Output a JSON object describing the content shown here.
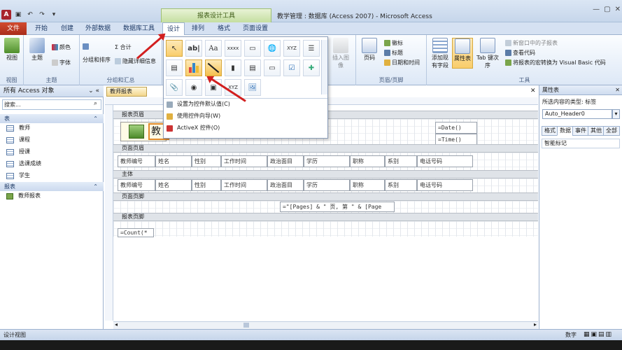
{
  "window": {
    "title": "教学管理 : 数据库 (Access 2007) - Microsoft Access",
    "context_tab": "报表设计工具",
    "controls": [
      "—",
      "▢",
      "✕"
    ]
  },
  "ribbon_tabs": [
    "文件",
    "开始",
    "创建",
    "外部数据",
    "数据库工具",
    "设计",
    "排列",
    "格式",
    "页面设置"
  ],
  "ribbon": {
    "view": {
      "label": "视图",
      "group": "视图"
    },
    "theme": {
      "label": "主题",
      "colors": "颜色",
      "fonts": "字体",
      "group": "主题"
    },
    "grouping": {
      "group_sort": "分组和排序",
      "totals": "Σ 合计",
      "hide_details": "隐藏详细信息",
      "group": "分组和汇总"
    },
    "insert_image": "插入图像",
    "header_footer": {
      "page_number": "页码",
      "logo": "徽标",
      "title": "标题",
      "date_time": "日期和时间",
      "group": "页眉/页脚"
    },
    "tools": {
      "add_fields": "添加现有字段",
      "property_sheet": "属性表",
      "tab_order": "Tab 键次序",
      "subreport": "新窗口中的子报表",
      "view_code": "查看代码",
      "convert_macros": "将报表的宏转换为 Visual Basic 代码",
      "group": "工具"
    }
  },
  "dropdown": {
    "menu": [
      "设置为控件默认值(C)",
      "使用控件向导(W)",
      "ActiveX 控件(O)"
    ]
  },
  "nav": {
    "header": "所有 Access 对象",
    "search_placeholder": "搜索...",
    "sections": [
      {
        "label": "表",
        "items": [
          "教师",
          "课程",
          "授课",
          "选课成绩",
          "学生"
        ]
      },
      {
        "label": "报表",
        "items": [
          "教师报表"
        ]
      }
    ]
  },
  "document": {
    "tab": "教师报表",
    "sections": [
      "报表页眉",
      "页面页眉",
      "主体",
      "页面页脚",
      "报表页脚"
    ],
    "report_header": {
      "title_text": "教",
      "date": "=Date()",
      "time": "=Time()"
    },
    "page_header_fields": [
      "教师编号",
      "姓名",
      "性别",
      "工作时间",
      "政治面目",
      "学历",
      "职称",
      "系别",
      "电话号码"
    ],
    "detail_fields": [
      "教师编号",
      "姓名",
      "性别",
      "工作时间",
      "政治面目",
      "学历",
      "职称",
      "系别",
      "电话号码"
    ],
    "page_footer": "=\"[Pages] & \" 页, 第 \" & [Page",
    "report_footer": "=Count(*"
  },
  "property_sheet": {
    "title": "属性表",
    "selection_type": "所选内容的类型: 标签",
    "selected": "Auto_Header0",
    "tabs": [
      "格式",
      "数据",
      "事件",
      "其他",
      "全部"
    ],
    "row_label": "智能标记"
  },
  "status": {
    "left": "设计视图",
    "right": "数字"
  }
}
